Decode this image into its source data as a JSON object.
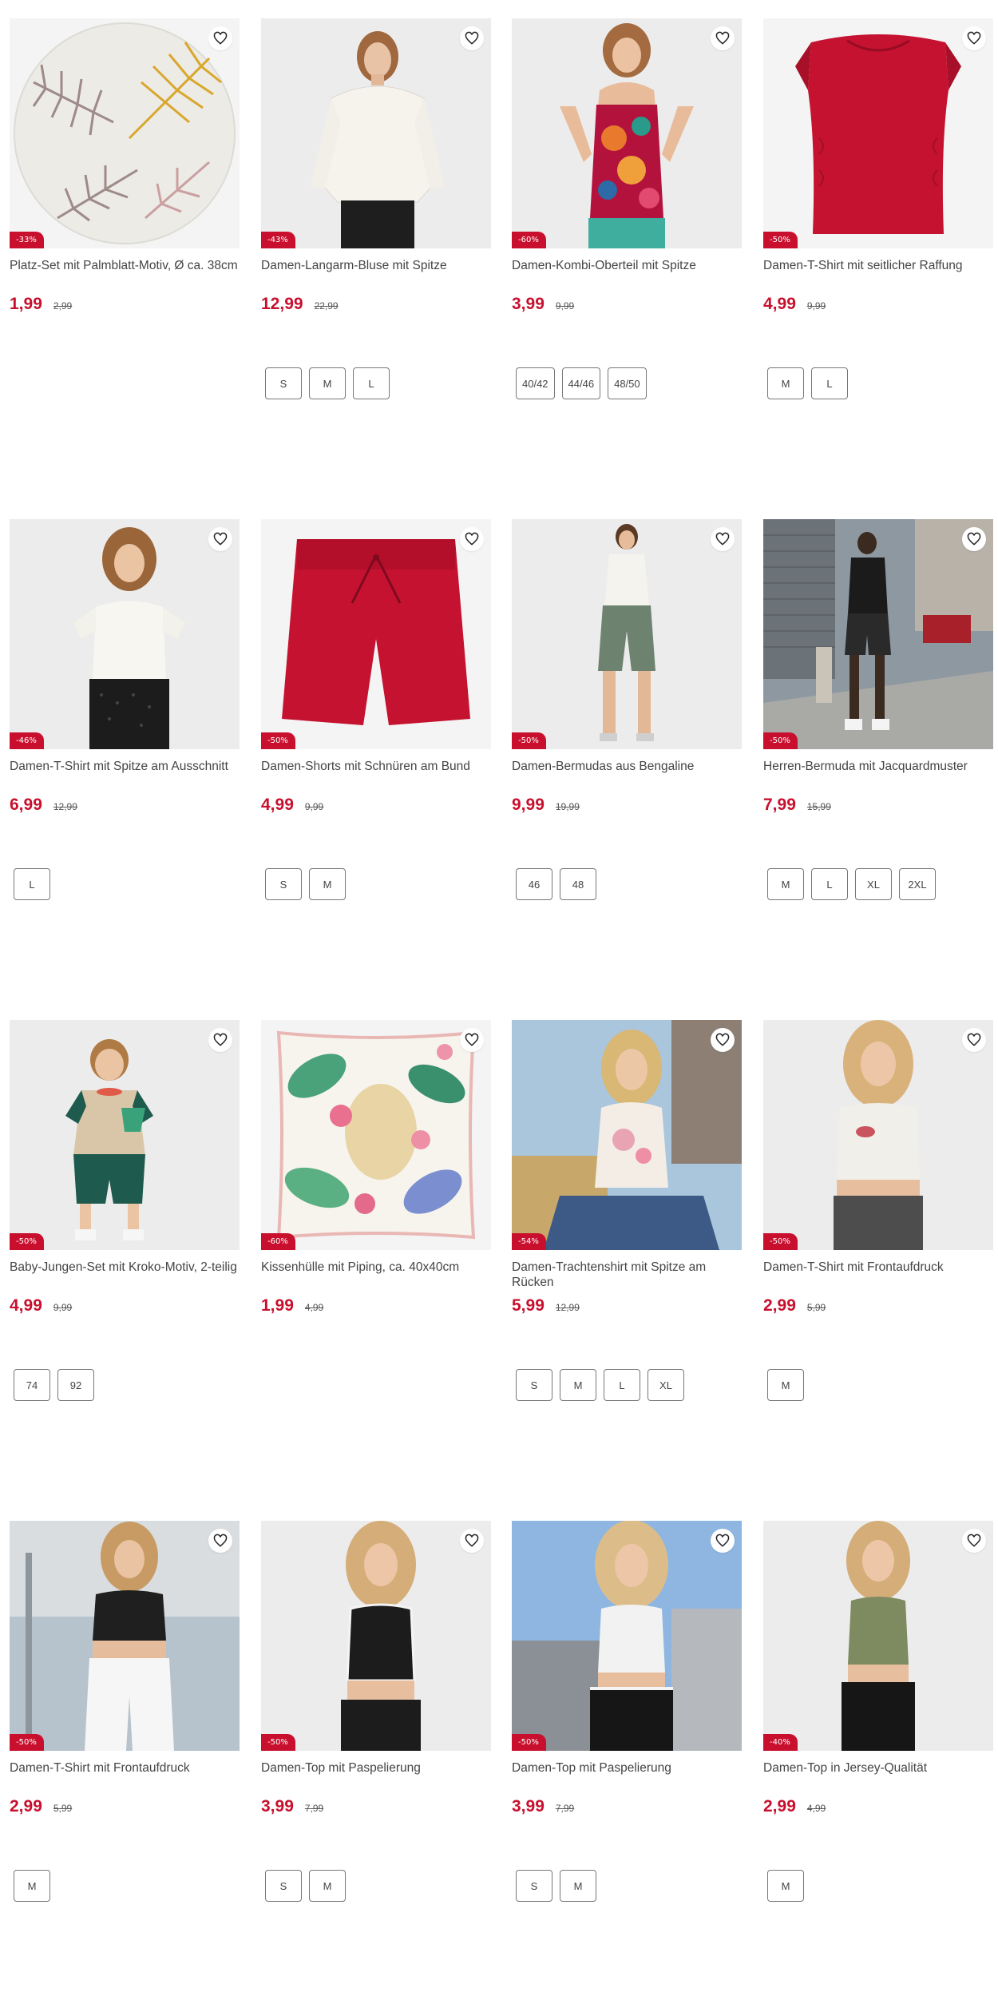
{
  "colors": {
    "accent_red": "#c8102e",
    "text": "#444444",
    "badge_text": "#ffffff"
  },
  "icons": {
    "wishlist": "heart-outline-icon"
  },
  "products": [
    {
      "name": "Platz-Set mit Palmblatt-Motiv, Ø ca. 38cm",
      "discount": "-33%",
      "price": "1,99",
      "old_price": "2,99",
      "sizes": []
    },
    {
      "name": "Damen-Langarm-Bluse mit Spitze",
      "discount": "-43%",
      "price": "12,99",
      "old_price": "22,99",
      "sizes": [
        "S",
        "M",
        "L"
      ]
    },
    {
      "name": "Damen-Kombi-Oberteil mit Spitze",
      "discount": "-60%",
      "price": "3,99",
      "old_price": "9,99",
      "sizes": [
        "40/42",
        "44/46",
        "48/50"
      ]
    },
    {
      "name": "Damen-T-Shirt mit seitlicher Raffung",
      "discount": "-50%",
      "price": "4,99",
      "old_price": "9,99",
      "sizes": [
        "M",
        "L"
      ]
    },
    {
      "name": "Damen-T-Shirt mit Spitze am Ausschnitt",
      "discount": "-46%",
      "price": "6,99",
      "old_price": "12,99",
      "sizes": [
        "L"
      ]
    },
    {
      "name": "Damen-Shorts mit Schnüren am Bund",
      "discount": "-50%",
      "price": "4,99",
      "old_price": "9,99",
      "sizes": [
        "S",
        "M"
      ]
    },
    {
      "name": "Damen-Bermudas aus Bengaline",
      "discount": "-50%",
      "price": "9,99",
      "old_price": "19,99",
      "sizes": [
        "46",
        "48"
      ]
    },
    {
      "name": "Herren-Bermuda mit Jacquardmuster",
      "discount": "-50%",
      "price": "7,99",
      "old_price": "15,99",
      "sizes": [
        "M",
        "L",
        "XL",
        "2XL"
      ]
    },
    {
      "name": "Baby-Jungen-Set mit Kroko-Motiv, 2-teilig",
      "discount": "-50%",
      "price": "4,99",
      "old_price": "9,99",
      "sizes": [
        "74",
        "92"
      ]
    },
    {
      "name": "Kissenhülle mit Piping, ca. 40x40cm",
      "discount": "-60%",
      "price": "1,99",
      "old_price": "4,99",
      "sizes": []
    },
    {
      "name": "Damen-Trachtenshirt mit Spitze am Rücken",
      "discount": "-54%",
      "price": "5,99",
      "old_price": "12,99",
      "sizes": [
        "S",
        "M",
        "L",
        "XL"
      ]
    },
    {
      "name": "Damen-T-Shirt mit Frontaufdruck",
      "discount": "-50%",
      "price": "2,99",
      "old_price": "5,99",
      "sizes": [
        "M"
      ]
    },
    {
      "name": "Damen-T-Shirt mit Frontaufdruck",
      "discount": "-50%",
      "price": "2,99",
      "old_price": "5,99",
      "sizes": [
        "M"
      ]
    },
    {
      "name": "Damen-Top mit Paspelierung",
      "discount": "-50%",
      "price": "3,99",
      "old_price": "7,99",
      "sizes": [
        "S",
        "M"
      ]
    },
    {
      "name": "Damen-Top mit Paspelierung",
      "discount": "-50%",
      "price": "3,99",
      "old_price": "7,99",
      "sizes": [
        "S",
        "M"
      ]
    },
    {
      "name": "Damen-Top in Jersey-Qualität",
      "discount": "-40%",
      "price": "2,99",
      "old_price": "4,99",
      "sizes": [
        "M"
      ]
    }
  ]
}
